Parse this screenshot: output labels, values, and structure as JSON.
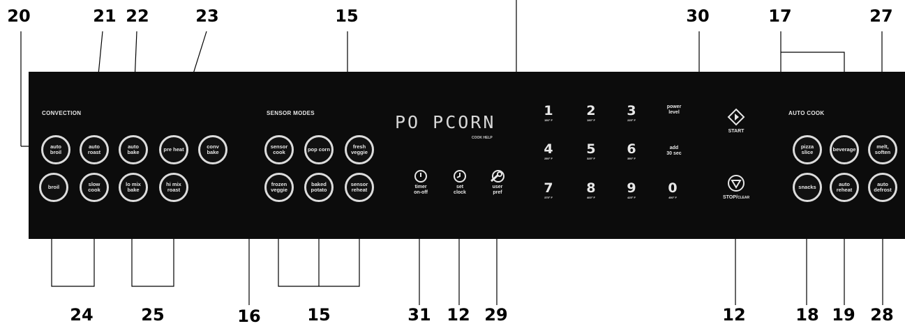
{
  "callouts_top": [
    "20",
    "21",
    "22",
    "23",
    "15",
    "30",
    "17",
    "27"
  ],
  "callouts_bottom": [
    "24",
    "25",
    "16",
    "15",
    "31",
    "12",
    "29",
    "12",
    "18",
    "19",
    "28"
  ],
  "panel": {
    "convection": {
      "title": "CONVECTION",
      "row1": [
        "auto broil",
        "auto roast",
        "auto bake",
        "pre heat",
        "conv bake"
      ],
      "row2": [
        "broil",
        "slow cook",
        "lo mix bake",
        "hi mix roast"
      ]
    },
    "sensor_modes": {
      "title": "SENSOR MODES",
      "row1": [
        "sensor cook",
        "pop corn",
        "fresh veggie"
      ],
      "row2": [
        "frozen veggie",
        "baked potato",
        "sensor reheat"
      ]
    },
    "display": {
      "text": "PO PCORN",
      "sub": "COOK HELP"
    },
    "function_keys": {
      "timer": "timer\non-off",
      "clock": "set\nclock",
      "user": "user\npref"
    },
    "numpad": [
      {
        "digit": "1",
        "sub": "150° F"
      },
      {
        "digit": "2",
        "sub": "190° F"
      },
      {
        "digit": "3",
        "sub": "225° F"
      },
      {
        "digit": "4",
        "sub": "250° F"
      },
      {
        "digit": "5",
        "sub": "325° F"
      },
      {
        "digit": "6",
        "sub": "350° F"
      },
      {
        "digit": "7",
        "sub": "375° F"
      },
      {
        "digit": "8",
        "sub": "400° F"
      },
      {
        "digit": "9",
        "sub": "425° F"
      },
      {
        "digit": "0",
        "sub": "450° F"
      }
    ],
    "power_level": "power\nlevel",
    "add_30": "add\n30 sec",
    "start": "START",
    "stop": "STOP/",
    "clear": "CLEAR",
    "auto_cook": {
      "title": "AUTO COOK",
      "row1": [
        "pizza slice",
        "beverage",
        "melt, soften"
      ],
      "row2": [
        "snacks",
        "auto reheat",
        "auto defrost"
      ]
    }
  }
}
